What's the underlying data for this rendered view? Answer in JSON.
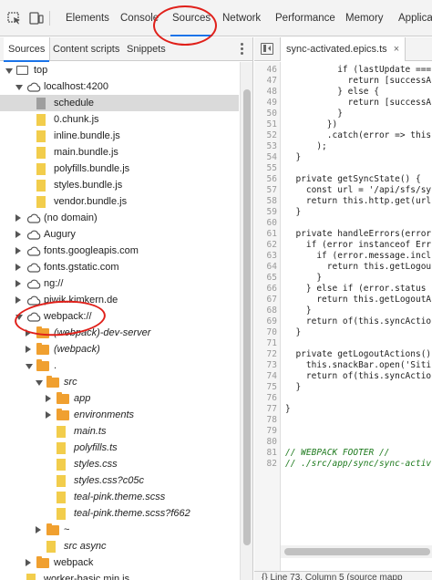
{
  "toolbar": {
    "tabs": [
      "Elements",
      "Console",
      "Sources",
      "Network",
      "Performance",
      "Memory",
      "Applicat"
    ],
    "active_tab": "Sources"
  },
  "navigator": {
    "tabs": [
      "Sources",
      "Content scripts",
      "Snippets"
    ],
    "tree": [
      {
        "label": "top",
        "type": "page",
        "arrow": "down"
      },
      {
        "label": "localhost:4200",
        "type": "cloud",
        "arrow": "down"
      },
      {
        "label": "schedule",
        "type": "file-gray",
        "selected": true
      },
      {
        "label": "0.chunk.js",
        "type": "file"
      },
      {
        "label": "inline.bundle.js",
        "type": "file"
      },
      {
        "label": "main.bundle.js",
        "type": "file"
      },
      {
        "label": "polyfills.bundle.js",
        "type": "file"
      },
      {
        "label": "styles.bundle.js",
        "type": "file"
      },
      {
        "label": "vendor.bundle.js",
        "type": "file"
      },
      {
        "label": "(no domain)",
        "type": "cloud",
        "arrow": "right"
      },
      {
        "label": "Augury",
        "type": "cloud",
        "arrow": "right"
      },
      {
        "label": "fonts.googleapis.com",
        "type": "cloud",
        "arrow": "right"
      },
      {
        "label": "fonts.gstatic.com",
        "type": "cloud",
        "arrow": "right"
      },
      {
        "label": "ng://",
        "type": "cloud",
        "arrow": "right"
      },
      {
        "label": "piwik.kimkern.de",
        "type": "cloud",
        "arrow": "right"
      },
      {
        "label": "webpack://",
        "type": "cloud",
        "arrow": "down"
      },
      {
        "label": "(webpack)-dev-server",
        "type": "folder",
        "arrow": "right",
        "italic": true
      },
      {
        "label": "(webpack)",
        "type": "folder",
        "arrow": "right",
        "italic": true
      },
      {
        "label": ".",
        "type": "folder",
        "arrow": "down"
      },
      {
        "label": "src",
        "type": "folder",
        "arrow": "down",
        "italic": true
      },
      {
        "label": "app",
        "type": "folder",
        "arrow": "right",
        "italic": true
      },
      {
        "label": "environments",
        "type": "folder",
        "arrow": "right",
        "italic": true
      },
      {
        "label": "main.ts",
        "type": "file",
        "italic": true
      },
      {
        "label": "polyfills.ts",
        "type": "file",
        "italic": true
      },
      {
        "label": "styles.css",
        "type": "file",
        "italic": true
      },
      {
        "label": "styles.css?c05c",
        "type": "file",
        "italic": true
      },
      {
        "label": "teal-pink.theme.scss",
        "type": "file",
        "italic": true
      },
      {
        "label": "teal-pink.theme.scss?f662",
        "type": "file",
        "italic": true
      },
      {
        "label": "~",
        "type": "folder",
        "arrow": "right"
      },
      {
        "label": "src async",
        "type": "file",
        "italic": true
      },
      {
        "label": "webpack",
        "type": "folder",
        "arrow": "right"
      },
      {
        "label": "worker-basic.min.js",
        "type": "file"
      }
    ]
  },
  "editor": {
    "tab_label": "sync-activated.epics.ts",
    "close_glyph": "×",
    "lines": [
      {
        "n": "46",
        "t": "          if (lastUpdate ==="
      },
      {
        "n": "47",
        "t": "            return [successA"
      },
      {
        "n": "48",
        "t": "          } else {"
      },
      {
        "n": "49",
        "t": "            return [successA"
      },
      {
        "n": "50",
        "t": "          }"
      },
      {
        "n": "51",
        "t": "        })"
      },
      {
        "n": "52",
        "t": "        .catch(error => this"
      },
      {
        "n": "53",
        "t": "      );"
      },
      {
        "n": "54",
        "t": "  }"
      },
      {
        "n": "55",
        "t": ""
      },
      {
        "n": "56",
        "t": "  private getSyncState() {"
      },
      {
        "n": "57",
        "t": "    const url = '/api/sfs/sy"
      },
      {
        "n": "58",
        "t": "    return this.http.get(url"
      },
      {
        "n": "59",
        "t": "  }"
      },
      {
        "n": "60",
        "t": ""
      },
      {
        "n": "61",
        "t": "  private handleErrors(error"
      },
      {
        "n": "62",
        "t": "    if (error instanceof Err"
      },
      {
        "n": "63",
        "t": "      if (error.message.incl"
      },
      {
        "n": "64",
        "t": "        return this.getLogou"
      },
      {
        "n": "65",
        "t": "      }"
      },
      {
        "n": "66",
        "t": "    } else if (error.status"
      },
      {
        "n": "67",
        "t": "      return this.getLogoutA"
      },
      {
        "n": "68",
        "t": "    }"
      },
      {
        "n": "69",
        "t": "    return of(this.syncActio"
      },
      {
        "n": "70",
        "t": "  }"
      },
      {
        "n": "71",
        "t": ""
      },
      {
        "n": "72",
        "t": "  private getLogoutActions()"
      },
      {
        "n": "73",
        "t": "    this.snackBar.open('Siti"
      },
      {
        "n": "74",
        "t": "    return of(this.syncActio"
      },
      {
        "n": "75",
        "t": "  }"
      },
      {
        "n": "76",
        "t": ""
      },
      {
        "n": "77",
        "t": "}"
      },
      {
        "n": "78",
        "t": ""
      },
      {
        "n": "79",
        "t": ""
      },
      {
        "n": "80",
        "t": ""
      },
      {
        "n": "81",
        "t": "// WEBPACK FOOTER //"
      },
      {
        "n": "82",
        "t": "// ./src/app/sync/sync-activ"
      }
    ],
    "status": "{}   Line 73, Column 5   (source mapp"
  },
  "colors": {
    "accent": "#1a73e8",
    "annotation": "#e0201a",
    "folder": "#f0a030",
    "file": "#f2cd4c"
  }
}
